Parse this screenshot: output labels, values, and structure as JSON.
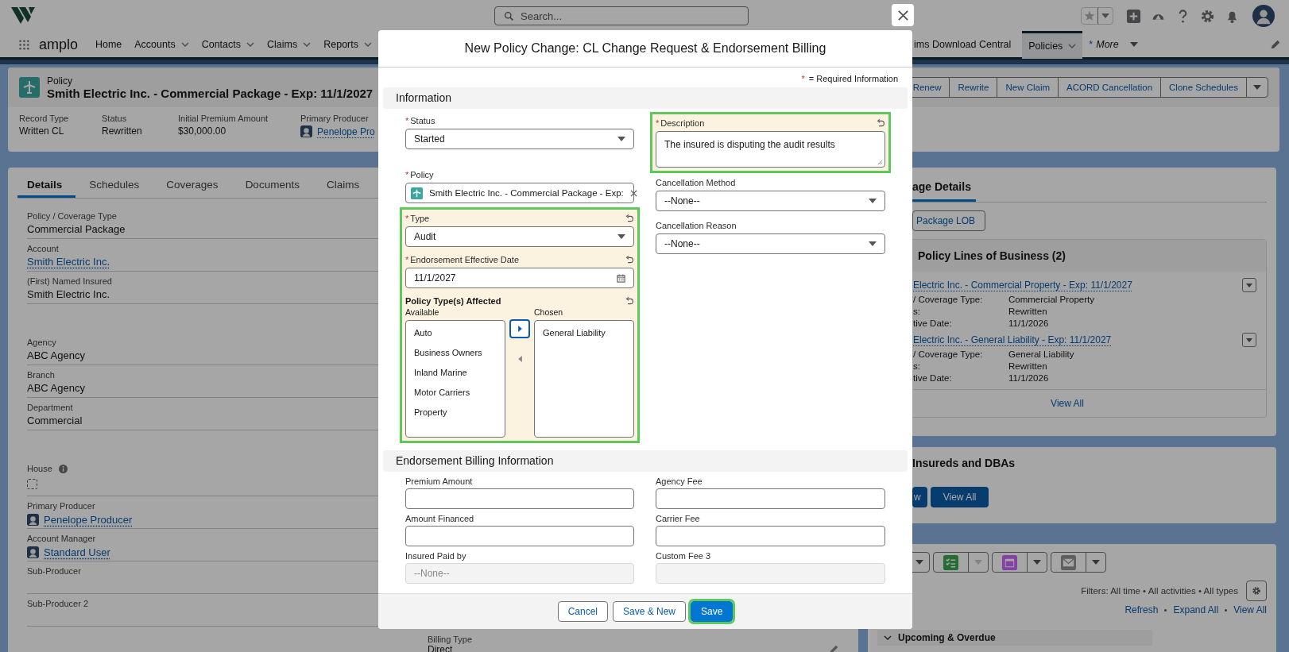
{
  "header": {
    "search": {
      "placeholder": "Search..."
    }
  },
  "nav": {
    "app_name": "amplo",
    "left": [
      {
        "label": "Home",
        "has_menu": false,
        "selected": false
      },
      {
        "label": "Accounts",
        "has_menu": true,
        "selected": false
      },
      {
        "label": "Contacts",
        "has_menu": true,
        "selected": false
      },
      {
        "label": "Claims",
        "has_menu": true,
        "selected": false
      },
      {
        "label": "Reports",
        "has_menu": true,
        "selected": false
      }
    ],
    "right": [
      {
        "label": "ims Download Central",
        "has_menu": false,
        "selected": false
      },
      {
        "label": "Policies",
        "has_menu": true,
        "selected": true
      }
    ],
    "more": {
      "marker": "*",
      "label": "More"
    }
  },
  "record": {
    "object_label": "Policy",
    "title": "Smith Electric Inc. - Commercial Package - Exp: 11/1/2027",
    "fields": [
      {
        "label": "Record Type",
        "value": "Written CL",
        "kind": "text"
      },
      {
        "label": "Status",
        "value": "Rewritten",
        "kind": "text"
      },
      {
        "label": "Initial Premium Amount",
        "value": "$30,000.00",
        "kind": "text"
      },
      {
        "label": "Primary Producer",
        "value": "Penelope Pro",
        "kind": "user-link"
      }
    ],
    "actions": [
      "Renew",
      "Rewrite",
      "New Claim",
      "ACORD Cancellation",
      "Clone Schedules"
    ]
  },
  "details": {
    "tabs": [
      {
        "label": "Details",
        "selected": true
      },
      {
        "label": "Schedules",
        "selected": false
      },
      {
        "label": "Coverages",
        "selected": false
      },
      {
        "label": "Documents",
        "selected": false
      },
      {
        "label": "Claims",
        "selected": false
      }
    ],
    "groups": [
      {
        "fields": [
          {
            "label": "Policy / Coverage Type",
            "value": "Commercial Package",
            "kind": "text"
          },
          {
            "label": "Account",
            "value": "Smith Electric Inc.",
            "kind": "link"
          },
          {
            "label": "(First) Named Insured",
            "value": "Smith Electric Inc.",
            "kind": "text"
          }
        ]
      },
      {
        "fields": [
          {
            "label": "Agency",
            "value": "ABC Agency",
            "kind": "text"
          },
          {
            "label": "Branch",
            "value": "ABC Agency",
            "kind": "text"
          },
          {
            "label": "Department",
            "value": "Commercial",
            "kind": "text"
          }
        ]
      },
      {
        "fields": [
          {
            "label": "House",
            "kind": "checkbox",
            "checked": false,
            "info": true
          },
          {
            "label": "Primary Producer",
            "value": "Penelope Producer",
            "kind": "user-link"
          },
          {
            "label": "Account Manager",
            "value": "Standard User",
            "kind": "user-link"
          },
          {
            "label": "Sub-Producer",
            "kind": "text"
          },
          {
            "label": "Sub-Producer 2",
            "kind": "text"
          }
        ]
      }
    ],
    "billing_type": {
      "label": "Billing Type",
      "value": "Direct"
    }
  },
  "side": {
    "lob": {
      "tab": "age Details",
      "button": "Package LOB",
      "related": {
        "title": "Policy Lines of Business (2)",
        "items": [
          {
            "title": "Electric Inc. - Commercial Property - Exp: 11/1/2027",
            "rows": [
              {
                "label": "/ Coverage Type:",
                "value": "Commercial Property"
              },
              {
                "label": "s:",
                "value": "Rewritten"
              },
              {
                "label": "tive Date:",
                "value": "11/1/2026"
              }
            ]
          },
          {
            "title": "Electric Inc. - General Liability - Exp: 11/1/2027",
            "rows": [
              {
                "label": "/ Coverage Type:",
                "value": "General Liability"
              },
              {
                "label": "s:",
                "value": "Rewritten"
              },
              {
                "label": "tive Date:",
                "value": "11/1/2026"
              }
            ]
          }
        ],
        "view_all": "View All"
      }
    },
    "insureds": {
      "title": "Insureds and DBAs",
      "buttons": [
        "w",
        "View All"
      ]
    },
    "activity": {
      "buttons": [
        {
          "kind": "menu",
          "menu_disabled": false
        },
        {
          "kind": "task",
          "menu_disabled": true
        },
        {
          "kind": "event",
          "menu_disabled": false
        },
        {
          "kind": "email",
          "menu_disabled": false
        }
      ],
      "filters": "Filters: All time • All activities • All types",
      "links": [
        "Refresh",
        "Expand All",
        "View All"
      ],
      "upcoming": "Upcoming & Overdue"
    }
  },
  "modal": {
    "title": "New Policy Change: CL Change Request & Endorsement Billing",
    "required_marker": "*",
    "required_note": "= Required Information",
    "info": {
      "title": "Information",
      "left": [
        {
          "highlighted": false,
          "fields": [
            {
              "kind": "select",
              "label": "Status",
              "required": true,
              "changed": false,
              "value": "Started"
            }
          ]
        },
        {
          "highlighted": false,
          "fields": [
            {
              "kind": "lookup",
              "label": "Policy",
              "required": true,
              "changed": false,
              "value": "Smith Electric Inc. - Commercial Package - Exp:"
            }
          ]
        },
        {
          "highlighted": true,
          "fields": [
            {
              "kind": "select",
              "label": "Type",
              "required": true,
              "changed": true,
              "value": "Audit"
            },
            {
              "kind": "date",
              "label": "Endorsement Effective Date",
              "required": true,
              "changed": true,
              "value": "11/1/2027"
            },
            {
              "kind": "dual-listbox",
              "label": "Policy Type(s) Affected",
              "required": false,
              "changed": true,
              "available_label": "Available",
              "chosen_label": "Chosen",
              "available": [
                "Auto",
                "Business Owners",
                "Inland Marine",
                "Motor Carriers",
                "Property"
              ],
              "chosen": [
                "General Liability"
              ]
            }
          ]
        }
      ],
      "right": [
        {
          "highlighted": true,
          "fields": [
            {
              "kind": "textarea",
              "label": "Description",
              "required": true,
              "changed": true,
              "value": "The insured is disputing the audit results"
            }
          ]
        },
        {
          "highlighted": false,
          "fields": [
            {
              "kind": "select",
              "label": "Cancellation Method",
              "required": false,
              "changed": false,
              "value": "--None--"
            }
          ]
        },
        {
          "highlighted": false,
          "fields": [
            {
              "kind": "select",
              "label": "Cancellation Reason",
              "required": false,
              "changed": false,
              "value": "--None--"
            }
          ]
        }
      ]
    },
    "billing": {
      "title": "Endorsement Billing Information",
      "fields": [
        {
          "kind": "input",
          "label": "Premium Amount",
          "disabled": false
        },
        {
          "kind": "input",
          "label": "Agency Fee",
          "disabled": false
        },
        {
          "kind": "input",
          "label": "Amount Financed",
          "disabled": false
        },
        {
          "kind": "input",
          "label": "Carrier Fee",
          "disabled": false
        },
        {
          "kind": "select",
          "label": "Insured Paid by",
          "disabled": true,
          "value": "--None--"
        },
        {
          "kind": "input",
          "label": "Custom Fee 3",
          "disabled": true
        }
      ]
    },
    "footer": [
      {
        "label": "Cancel",
        "kind": "neutral",
        "highlighted": false
      },
      {
        "label": "Save & New",
        "kind": "neutral",
        "highlighted": false
      },
      {
        "label": "Save",
        "kind": "brand",
        "highlighted": true
      }
    ]
  }
}
